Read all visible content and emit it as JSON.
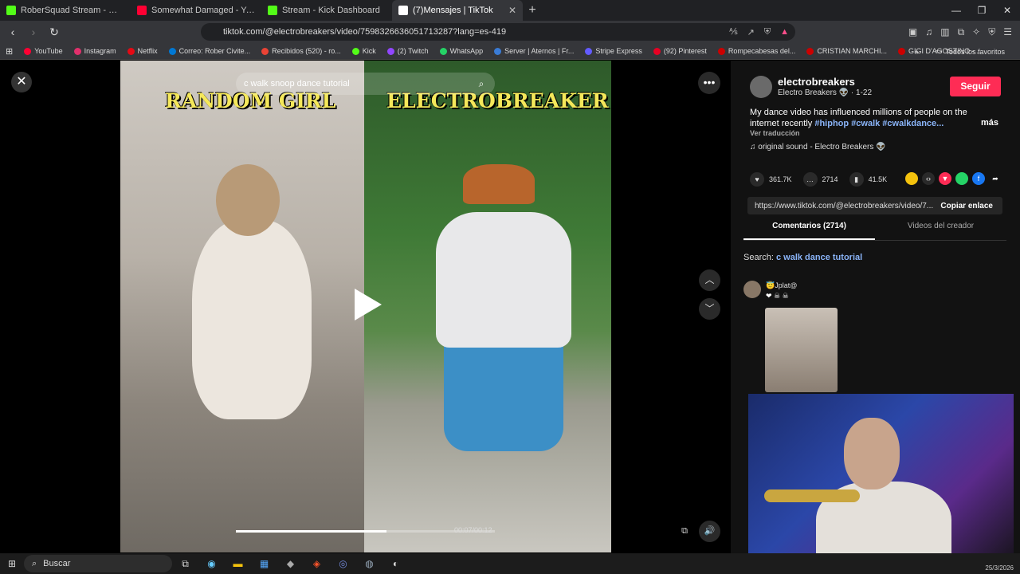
{
  "browser": {
    "tabs": [
      {
        "title": "RoberSquad Stream - Watch Live",
        "color": "#53fc18",
        "active": false
      },
      {
        "title": "Somewhat Damaged - YouTube",
        "color": "#ff0033",
        "active": false
      },
      {
        "title": "Stream - Kick Dashboard",
        "color": "#53fc18",
        "active": false
      },
      {
        "title": "(7)Mensajes | TikTok",
        "color": "#ffffff",
        "active": true
      }
    ],
    "url": "tiktok.com/@electrobreakers/video/7598326636051713287?lang=es-419",
    "bookmarks": [
      {
        "label": "YouTube",
        "color": "#ff0033"
      },
      {
        "label": "Instagram",
        "color": "#e1306c"
      },
      {
        "label": "Netflix",
        "color": "#e50914"
      },
      {
        "label": "Correo: Rober Civite...",
        "color": "#0078d4"
      },
      {
        "label": "Recibidos (520) - ro...",
        "color": "#ea4335"
      },
      {
        "label": "Kick",
        "color": "#53fc18"
      },
      {
        "label": "(2) Twitch",
        "color": "#9146ff"
      },
      {
        "label": "WhatsApp",
        "color": "#25d366"
      },
      {
        "label": "Server | Aternos | Fr...",
        "color": "#3a7bd5"
      },
      {
        "label": "Stripe Express",
        "color": "#635bff"
      },
      {
        "label": "(92) Pinterest",
        "color": "#e60023"
      },
      {
        "label": "Rompecabesas del...",
        "color": "#cc0000"
      },
      {
        "label": "CRISTIAN MARCHI...",
        "color": "#cc0000"
      },
      {
        "label": "GIGI D'AGOSTINO -...",
        "color": "#cc0000"
      }
    ],
    "all_favorites": "Todos los favoritos"
  },
  "video": {
    "search_text": "c walk snoop dance tutorial",
    "left_label": "RANDOM GIRL",
    "right_label": "ELECTROBREAKER",
    "time": "00:07/00:12",
    "progress_fraction": 0.58
  },
  "panel": {
    "username": "electrobreakers",
    "display": "Electro Breakers 👽 · 1-22",
    "follow": "Seguir",
    "desc_text": "My dance video has influenced millions of people on the internet recently ",
    "tags": "#hiphop #cwalk #cwalkdance...",
    "more": "más",
    "translate": "Ver traducción",
    "sound": "♫  original sound - Electro Breakers 👽",
    "likes": "361.7K",
    "comments": "2714",
    "saves": "41.5K",
    "link": "https://www.tiktok.com/@electrobreakers/video/7...",
    "copy": "Copiar enlace",
    "tab_comments": "Comentarios (2714)",
    "tab_videos": "Videos del creador",
    "search_prefix": "Search: ",
    "search_term": "c walk dance tutorial",
    "comment_user": "😇Jplat@",
    "comment_emoji": "❤ ☠ ☠"
  },
  "taskbar": {
    "search": "Buscar",
    "date": "25/3/2026"
  }
}
